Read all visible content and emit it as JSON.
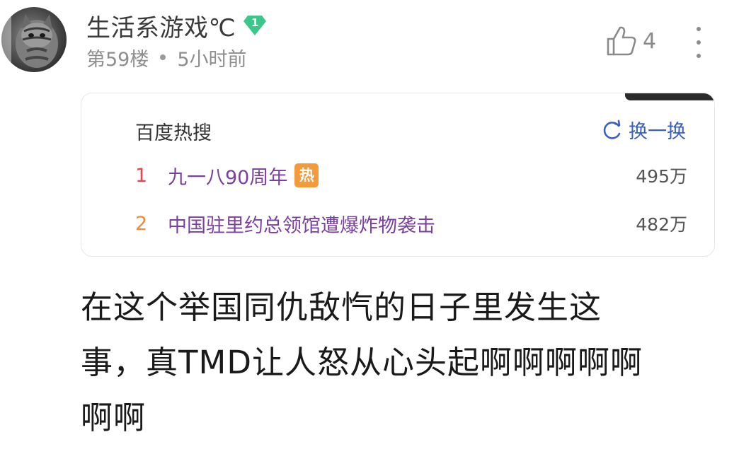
{
  "post": {
    "username": "生活系游戏℃",
    "level": "1",
    "floor": "第59楼",
    "time": "5小时前",
    "likes": "4"
  },
  "hot_search": {
    "title": "百度热搜",
    "refresh_label": "换一换",
    "items": [
      {
        "rank": "1",
        "text": "九一八90周年",
        "tag": "热",
        "count": "495万",
        "rank_color": "#e8474f"
      },
      {
        "rank": "2",
        "text": "中国驻里约总领馆遭爆炸物袭击",
        "tag": "",
        "count": "482万",
        "rank_color": "#f08a3c"
      }
    ]
  },
  "content": {
    "line1": "在这个举国同仇敌忾的日子里发生这",
    "line2": "事，真TMD让人怒从心头起啊啊啊啊啊",
    "line3": "啊啊"
  },
  "icons": {
    "level": "diamond-badge-icon",
    "like": "thumbs-up-icon",
    "more": "more-vertical-icon",
    "refresh": "refresh-icon"
  },
  "colors": {
    "level_badge": "#3cc68a",
    "refresh": "#3a5fbf",
    "hot_text": "#7a3fa0",
    "hot_tag": "#f49a3a"
  }
}
